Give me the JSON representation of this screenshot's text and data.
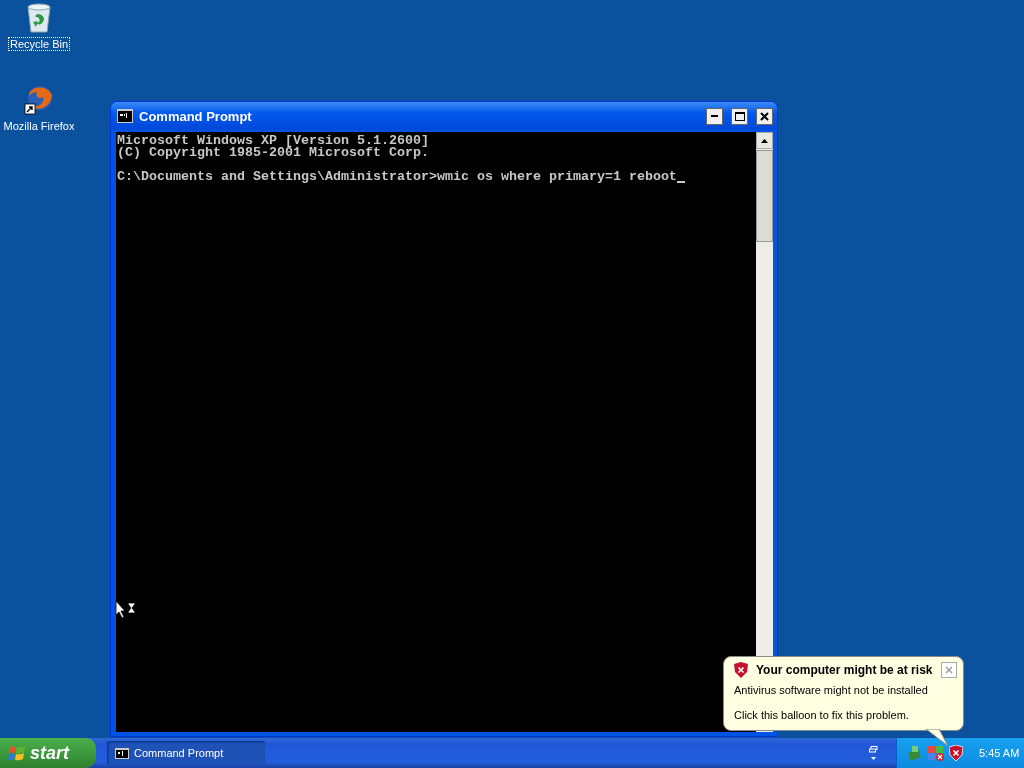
{
  "desktop_icons": [
    {
      "kind": "recycle",
      "label": "Recycle Bin",
      "selected": true
    },
    {
      "kind": "browser",
      "label": "Mozilla Firefox",
      "selected": false
    }
  ],
  "window": {
    "title": "Command Prompt",
    "active": true,
    "console": {
      "lines": [
        "Microsoft Windows XP [Version 5.1.2600]",
        "(C) Copyright 1985-2001 Microsoft Corp."
      ],
      "prompt": "C:\\Documents and Settings\\Administrator>",
      "command": "wmic os where primary=1 reboot"
    }
  },
  "balloon": {
    "title": "Your computer might be at risk",
    "lines": [
      "Antivirus software might not be installed",
      "Click this balloon to fix this problem."
    ]
  },
  "taskbar": {
    "start_label": "start",
    "tasks": [
      {
        "label": "Command Prompt",
        "selected": true
      }
    ],
    "clock": "5:45 AM"
  }
}
